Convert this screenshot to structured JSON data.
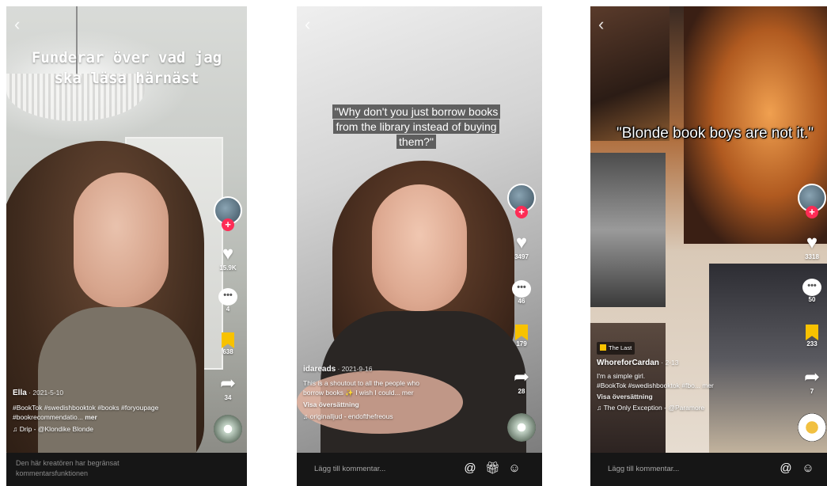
{
  "panels": [
    {
      "back_icon": "‹",
      "caption": "Funderar över vad jag ska läsa härnäst",
      "rail": {
        "likes": "15.9K",
        "comments": "4",
        "saves": "638",
        "shares": "34"
      },
      "info": {
        "user": "Ella",
        "date": " · 2021-5-10",
        "hashtags": "#BookTok #swedishbooktok #books #foryoupage #bookrecommendatio...",
        "more": "mer",
        "music": "♫ Drip - @Klondike Blonde"
      },
      "bottom_notice": "Den här kreatören har begränsat kommentarsfunktionen"
    },
    {
      "back_icon": "‹",
      "caption": "\"Why don't you just borrow books from the library instead of buying them?\"",
      "rail": {
        "likes": "3497",
        "comments": "46",
        "saves": "179",
        "shares": "28"
      },
      "info": {
        "user": "idareads",
        "date": " · 2021-9-16",
        "line1": "This is a shoutout to all the people who",
        "line2": "borrow books ✨ I wish I could... mer",
        "translation": "Visa översättning",
        "music": "♫ originalljud - endofthefreous"
      },
      "comment_placeholder": "Lägg till kommentar..."
    },
    {
      "back_icon": "‹",
      "caption": "\"Blonde book boys are not it.\"",
      "rail": {
        "likes": "3318",
        "comments": "50",
        "saves": "233",
        "shares": "7"
      },
      "info": {
        "chip": "The Last",
        "user": "WhoreforCardan",
        "date": " · 2-13",
        "line1": "I'm a simple girl.",
        "hashtags": "#BookTok #swedishbooktok #fbo... mer",
        "translation": "Visa översättning",
        "music": "♫ The Only Exception - @Paramore"
      },
      "comment_placeholder": "Lägg till kommentar..."
    }
  ]
}
